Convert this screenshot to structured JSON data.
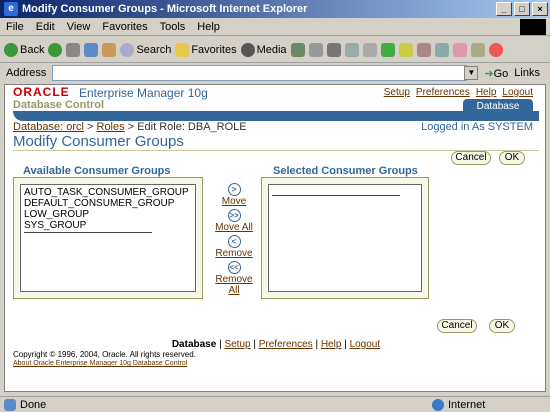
{
  "window": {
    "title": "Modify Consumer Groups - Microsoft Internet Explorer",
    "controls": [
      "_",
      "□",
      "×"
    ]
  },
  "menu": [
    "File",
    "Edit",
    "View",
    "Favorites",
    "Tools",
    "Help"
  ],
  "toolbar": {
    "back": "Back",
    "search": "Search",
    "favorites": "Favorites",
    "media": "Media"
  },
  "address": {
    "label": "Address",
    "value": "",
    "go": "Go",
    "links": "Links"
  },
  "header": {
    "oracle": "ORACLE",
    "em": "Enterprise Manager 10g",
    "db_control": "Database Control",
    "links": [
      "Setup",
      "Preferences",
      "Help",
      "Logout"
    ],
    "tab": "Database"
  },
  "breadcrumb": {
    "db": "Database: orcl",
    "sep1": ">",
    "roles": "Roles",
    "sep2": ">",
    "current": "Edit Role: DBA_ROLE"
  },
  "logged_in": "Logged in As SYSTEM",
  "page_title": "Modify Consumer Groups",
  "buttons": {
    "cancel": "Cancel",
    "ok": "OK"
  },
  "available": {
    "header": "Available Consumer Groups",
    "items": [
      "AUTO_TASK_CONSUMER_GROUP",
      "DEFAULT_CONSUMER_GROUP",
      "LOW_GROUP",
      "SYS_GROUP"
    ]
  },
  "selected": {
    "header": "Selected Consumer Groups",
    "items": []
  },
  "shuttle": {
    "move": "Move",
    "move_all": "Move All",
    "remove": "Remove",
    "remove_all_1": "Remove",
    "remove_all_2": "All"
  },
  "footer": {
    "database": "Database",
    "links": [
      "Setup",
      "Preferences",
      "Help",
      "Logout"
    ],
    "copyright": "Copyright © 1996, 2004, Oracle. All rights reserved.",
    "about": "About Oracle Enterprise Manager 10g Database Control"
  },
  "status": {
    "text": "Done",
    "zone": "Internet"
  }
}
